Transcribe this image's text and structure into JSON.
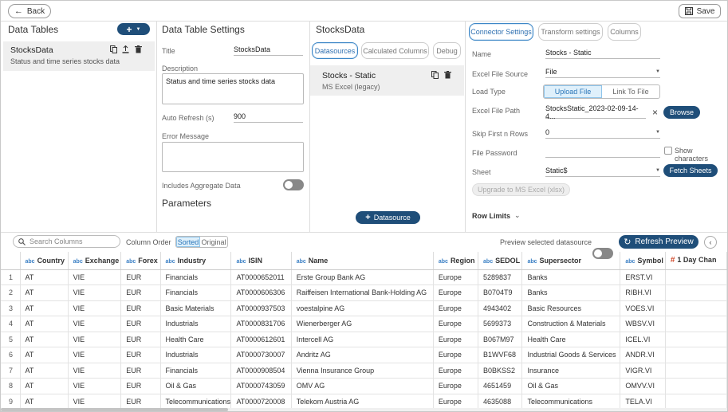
{
  "toolbar": {
    "back_label": "Back",
    "save_label": "Save"
  },
  "data_tables": {
    "heading": "Data Tables",
    "add_label": "+",
    "item": {
      "name": "StocksData",
      "description": "Status and time series stocks data"
    }
  },
  "settings": {
    "heading": "Data Table Settings",
    "title_label": "Title",
    "title_value": "StocksData",
    "description_label": "Description",
    "description_value": "Status and time series stocks data",
    "auto_refresh_label": "Auto Refresh (s)",
    "auto_refresh_value": "900",
    "error_label": "Error Message",
    "aggregate_label": "Includes Aggregate Data",
    "parameters_heading": "Parameters"
  },
  "stocksdata": {
    "heading": "StocksData",
    "tabs": [
      "Datasources",
      "Calculated Columns",
      "Debug"
    ],
    "datasource": {
      "name": "Stocks - Static",
      "type": "MS Excel (legacy)"
    },
    "add_datasource_label": "Datasource"
  },
  "connector": {
    "tabs": [
      "Connector Settings",
      "Transform settings",
      "Columns"
    ],
    "name_label": "Name",
    "name_value": "Stocks - Static",
    "source_label": "Excel File Source",
    "source_value": "File",
    "load_type_label": "Load Type",
    "load_type_options": [
      "Upload File",
      "Link To File"
    ],
    "file_path_label": "Excel File Path",
    "file_path_value": "StocksStatic_2023-02-09-14-4...",
    "browse_label": "Browse",
    "skip_label": "Skip First n Rows",
    "skip_value": "0",
    "password_label": "File Password",
    "show_chars_label": "Show characters",
    "sheet_label": "Sheet",
    "sheet_value": "Static$",
    "fetch_label": "Fetch Sheets",
    "upgrade_label": "Upgrade to MS Excel (xlsx)",
    "row_limits_label": "Row Limits"
  },
  "preview": {
    "search_placeholder": "Search Columns",
    "column_order_label": "Column Order",
    "order_options": [
      "Sorted",
      "Original"
    ],
    "preview_selected_label": "Preview selected datasource",
    "refresh_label": "Refresh Preview"
  },
  "grid": {
    "columns": [
      {
        "type": "abc",
        "name": "Country"
      },
      {
        "type": "abc",
        "name": "Exchange"
      },
      {
        "type": "abc",
        "name": "Forex"
      },
      {
        "type": "abc",
        "name": "Industry"
      },
      {
        "type": "abc",
        "name": "ISIN"
      },
      {
        "type": "abc",
        "name": "Name"
      },
      {
        "type": "abc",
        "name": "Region"
      },
      {
        "type": "abc",
        "name": "SEDOL"
      },
      {
        "type": "abc",
        "name": "Supersector"
      },
      {
        "type": "abc",
        "name": "Symbol"
      },
      {
        "type": "#",
        "name": "1 Day Chan"
      }
    ],
    "rows": [
      [
        "1",
        "AT",
        "VIE",
        "EUR",
        "Financials",
        "AT0000652011",
        "Erste Group Bank AG",
        "Europe",
        "5289837",
        "Banks",
        "ERST.VI",
        ""
      ],
      [
        "2",
        "AT",
        "VIE",
        "EUR",
        "Financials",
        "AT0000606306",
        "Raiffeisen International Bank-Holding AG",
        "Europe",
        "B0704T9",
        "Banks",
        "RIBH.VI",
        ""
      ],
      [
        "3",
        "AT",
        "VIE",
        "EUR",
        "Basic Materials",
        "AT0000937503",
        "voestalpine AG",
        "Europe",
        "4943402",
        "Basic Resources",
        "VOES.VI",
        ""
      ],
      [
        "4",
        "AT",
        "VIE",
        "EUR",
        "Industrials",
        "AT0000831706",
        "Wienerberger AG",
        "Europe",
        "5699373",
        "Construction & Materials",
        "WBSV.VI",
        ""
      ],
      [
        "5",
        "AT",
        "VIE",
        "EUR",
        "Health Care",
        "AT0000612601",
        "Intercell AG",
        "Europe",
        "B067M97",
        "Health Care",
        "ICEL.VI",
        ""
      ],
      [
        "6",
        "AT",
        "VIE",
        "EUR",
        "Industrials",
        "AT0000730007",
        "Andritz AG",
        "Europe",
        "B1WVF68",
        "Industrial Goods & Services",
        "ANDR.VI",
        ""
      ],
      [
        "7",
        "AT",
        "VIE",
        "EUR",
        "Financials",
        "AT0000908504",
        "Vienna Insurance Group",
        "Europe",
        "B0BKSS2",
        "Insurance",
        "VIGR.VI",
        ""
      ],
      [
        "8",
        "AT",
        "VIE",
        "EUR",
        "Oil & Gas",
        "AT0000743059",
        "OMV AG",
        "Europe",
        "4651459",
        "Oil & Gas",
        "OMVV.VI",
        ""
      ],
      [
        "9",
        "AT",
        "VIE",
        "EUR",
        "Telecommunications",
        "AT0000720008",
        "Telekom Austria AG",
        "Europe",
        "4635088",
        "Telecommunications",
        "TELA.VI",
        ""
      ]
    ]
  }
}
